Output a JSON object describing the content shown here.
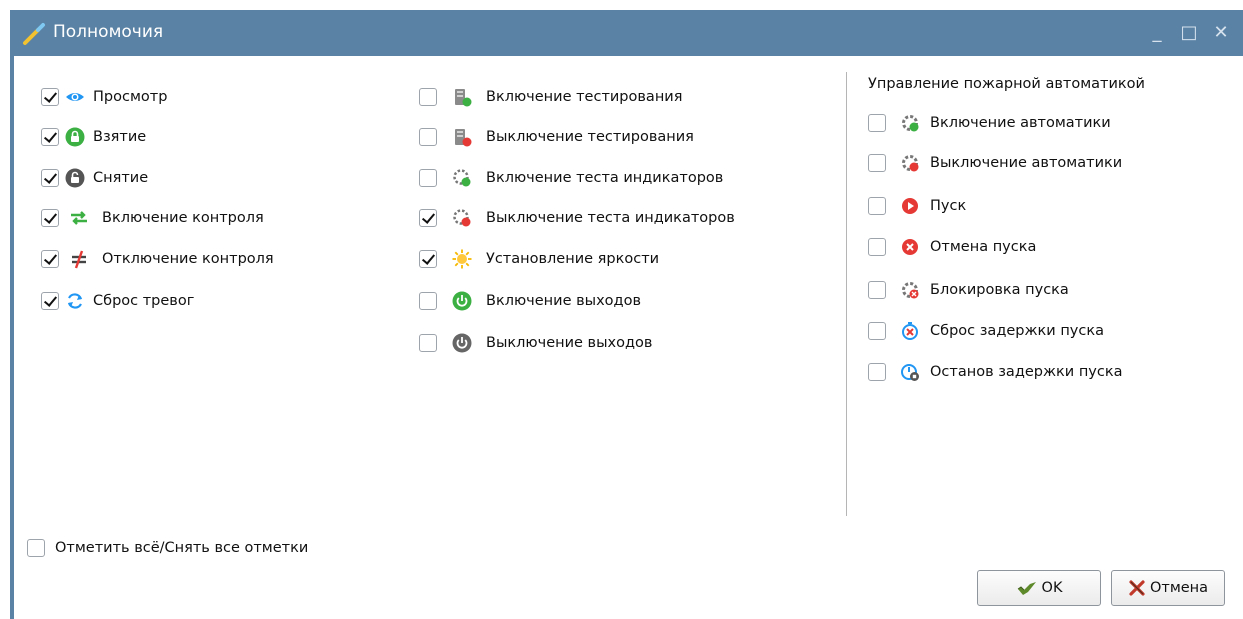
{
  "window": {
    "title": "Полномочия",
    "colors": {
      "titlebar": "#5a82a4",
      "title_text": "#ffffff"
    },
    "controls": {
      "minimize": "_",
      "maximize": "□",
      "close": "✕"
    }
  },
  "column1": [
    {
      "label": "Просмотр",
      "checked": true,
      "icon": "eye-icon"
    },
    {
      "label": "Взятие",
      "checked": true,
      "icon": "lock-closed-icon"
    },
    {
      "label": "Снятие",
      "checked": true,
      "icon": "lock-open-icon"
    },
    {
      "label": "Включение контроля",
      "checked": true,
      "icon": "arrows-exchange-icon"
    },
    {
      "label": "Отключение контроля",
      "checked": true,
      "icon": "not-equal-icon"
    },
    {
      "label": "Сброс тревог",
      "checked": true,
      "icon": "refresh-icon"
    }
  ],
  "column2": [
    {
      "label": "Включение тестирования",
      "checked": false,
      "icon": "device-test-on-icon"
    },
    {
      "label": "Выключение тестирования",
      "checked": false,
      "icon": "device-test-off-icon"
    },
    {
      "label": "Включение теста индикаторов",
      "checked": false,
      "icon": "indicator-test-on-icon"
    },
    {
      "label": "Выключение теста индикаторов",
      "checked": true,
      "icon": "indicator-test-off-icon"
    },
    {
      "label": "Установление яркости",
      "checked": true,
      "icon": "sun-icon"
    },
    {
      "label": "Включение выходов",
      "checked": false,
      "icon": "power-on-icon"
    },
    {
      "label": "Выключение выходов",
      "checked": false,
      "icon": "power-off-icon"
    }
  ],
  "fire_automation": {
    "title": "Управление пожарной автоматикой",
    "items": [
      {
        "label": "Включение автоматики",
        "checked": false,
        "icon": "gear-on-icon"
      },
      {
        "label": "Выключение автоматики",
        "checked": false,
        "icon": "gear-off-icon"
      },
      {
        "label": "Пуск",
        "checked": false,
        "icon": "play-icon"
      },
      {
        "label": "Отмена пуска",
        "checked": false,
        "icon": "cancel-icon"
      },
      {
        "label": "Блокировка пуска",
        "checked": false,
        "icon": "gear-block-icon"
      },
      {
        "label": "Сброс задержки пуска",
        "checked": false,
        "icon": "timer-reset-icon"
      },
      {
        "label": "Останов задержки пуска",
        "checked": false,
        "icon": "timer-stop-icon"
      }
    ]
  },
  "select_all": {
    "label": "Отметить всё/Снять все отметки",
    "checked": false
  },
  "buttons": {
    "ok": "OK",
    "cancel": "Отмена"
  }
}
